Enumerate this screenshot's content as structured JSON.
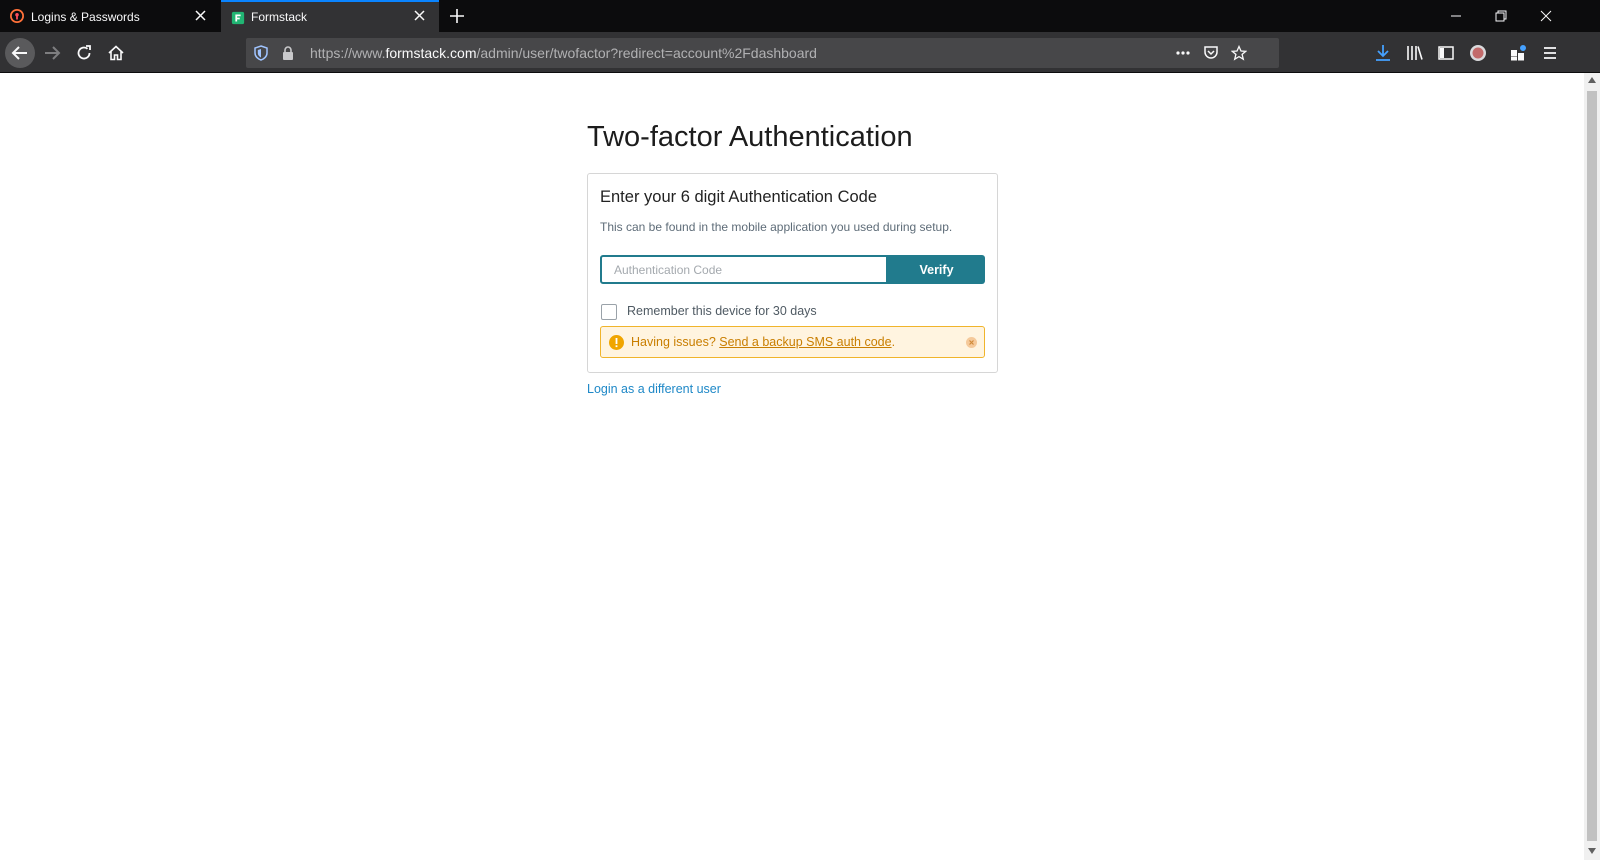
{
  "browser": {
    "tabs": [
      {
        "title": "Logins & Passwords",
        "icon": "lockwise-icon",
        "active": false
      },
      {
        "title": "Formstack",
        "icon": "formstack-favicon",
        "active": true
      }
    ],
    "url": {
      "prefix": "https://www.",
      "host": "formstack.com",
      "path": "/admin/user/twofactor?redirect=account%2Fdashboard"
    },
    "colors": {
      "tab_accent": "#0a84ff",
      "download_accent": "#45a1ff"
    }
  },
  "page": {
    "title": "Two-factor Authentication",
    "card": {
      "heading": "Enter your 6 digit Authentication Code",
      "subtext": "This can be found in the mobile application you used during setup.",
      "input_placeholder": "Authentication Code",
      "input_value": "",
      "verify_label": "Verify",
      "remember_label": "Remember this device for 30 days",
      "remember_checked": false,
      "alert": {
        "prefix": "Having issues?",
        "link_text": "Send a backup SMS auth code",
        "suffix": "."
      }
    },
    "different_user_link": "Login as a different user",
    "colors": {
      "primary": "#217b8d",
      "link": "#1e88c7",
      "alert_text": "#c97e00",
      "alert_bg": "#fff4e0"
    }
  }
}
